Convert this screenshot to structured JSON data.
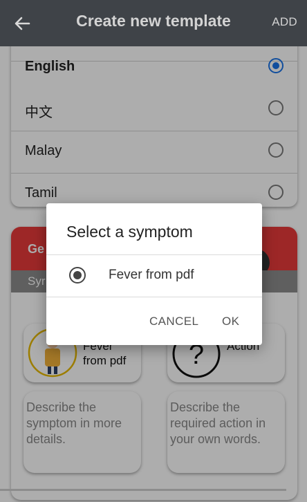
{
  "header": {
    "title": "Create new template",
    "add_label": "ADD"
  },
  "languages": [
    {
      "label": "English",
      "selected": true
    },
    {
      "label": "中文",
      "selected": false
    },
    {
      "label": "Malay",
      "selected": false
    },
    {
      "label": "Tamil",
      "selected": false
    }
  ],
  "symptom_card": {
    "title_fragment": "Ge",
    "subtitle_fragment": "Syr",
    "symptom_tile_label": "Fever from pdf",
    "action_tile_label": "Action",
    "symptom_description_placeholder": "Describe the symptom in more details.",
    "action_description_placeholder": "Describe the required action in your own words."
  },
  "dialog": {
    "title": "Select a symptom",
    "option_label": "Fever from pdf",
    "cancel_label": "CANCEL",
    "ok_label": "OK"
  },
  "colors": {
    "header_bg": "#3f4348",
    "accent": "#1a73e8",
    "card_header": "#e73a3a"
  }
}
